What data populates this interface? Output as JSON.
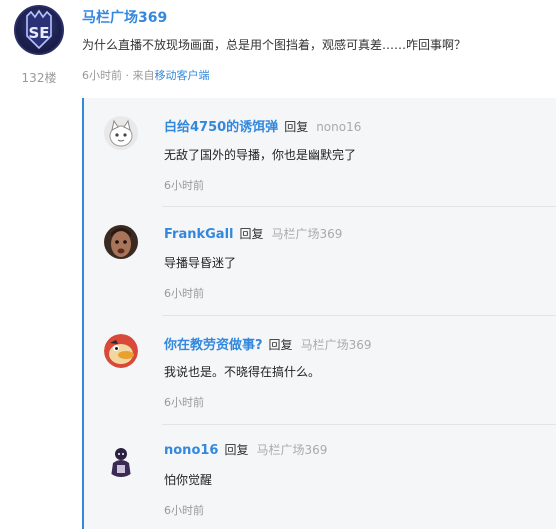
{
  "post": {
    "author": "马栏广场369",
    "content": "为什么直播不放现场画面，总是用个图挡着，观感可真差……咋回事啊？",
    "time": "6小时前 · 来自",
    "source": "移动客户端",
    "floor": "132楼",
    "avatar_text": "SE"
  },
  "replies": [
    {
      "name": "白给4750的诱饵弹",
      "reply_label": "回复",
      "target": "nono16",
      "text": "无敌了国外的导播，你也是幽默完了",
      "time": "6小时前",
      "avatar": "white-cat-avatar"
    },
    {
      "name": "FrankGall",
      "reply_label": "回复",
      "target": "马栏广场369",
      "text": "导播导昏迷了",
      "time": "6小时前",
      "avatar": "man-face-avatar"
    },
    {
      "name": "你在教劳资做事?",
      "reply_label": "回复",
      "target": "马栏广场369",
      "text": "我说也是。不晓得在搞什么。",
      "time": "6小时前",
      "avatar": "cartoon-duck-avatar"
    },
    {
      "name": "nono16",
      "reply_label": "回复",
      "target": "马栏广场369",
      "text": "怕你觉醒",
      "time": "6小时前",
      "avatar": "dark-figure-avatar"
    }
  ],
  "colors": {
    "link": "#3388dd",
    "reply_bg": "#f5f6f8",
    "accent_line": "#3388dd"
  }
}
